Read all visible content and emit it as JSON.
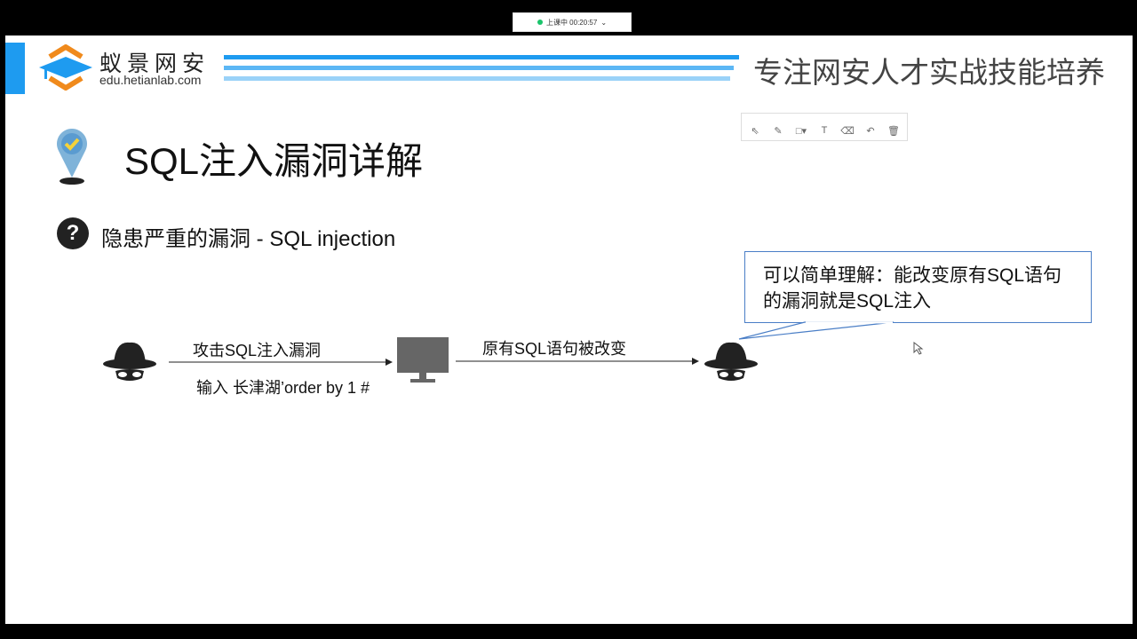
{
  "status": {
    "text": "上课中 00:20:57",
    "chevron": "⌄"
  },
  "header": {
    "brand": "蚁景网安",
    "url": "edu.hetianlab.com",
    "slogan": "专注网安人才实战技能培养"
  },
  "toolbar": {
    "tools": [
      "select",
      "pen",
      "rectangle",
      "text",
      "eraser",
      "undo",
      "delete"
    ]
  },
  "slide": {
    "title": "SQL注入漏洞详解",
    "subtitle": "隐患严重的漏洞 - SQL injection",
    "callout": "可以简单理解：能改变原有SQL语句的漏洞就是SQL注入",
    "arrow1_top": "攻击SQL注入漏洞",
    "arrow1_bottom": "输入 长津湖’order by 1 #",
    "arrow2_top": "原有SQL语句被改变"
  }
}
